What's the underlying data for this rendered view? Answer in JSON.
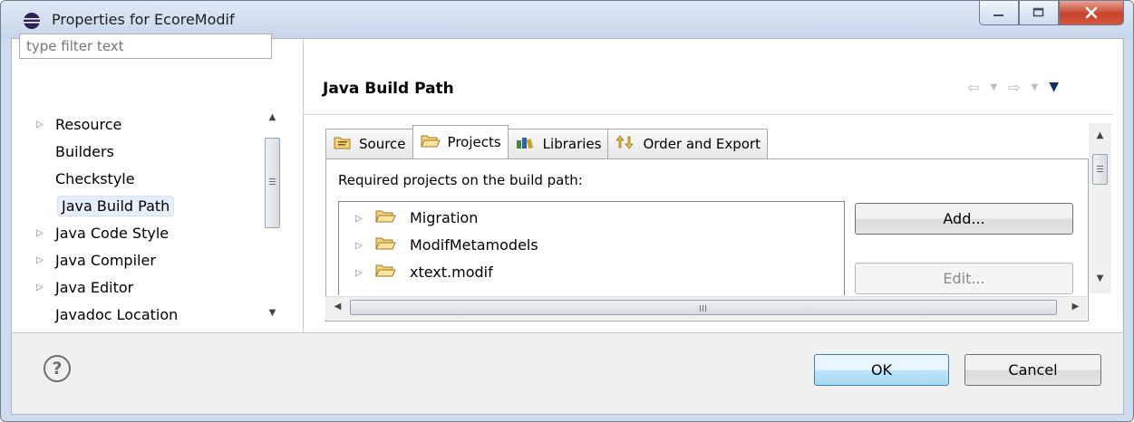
{
  "window": {
    "title": "Properties for EcoreModif"
  },
  "filter": {
    "placeholder": "type filter text"
  },
  "tree": {
    "items": [
      {
        "label": "Resource",
        "expandable": true
      },
      {
        "label": "Builders",
        "expandable": false
      },
      {
        "label": "Checkstyle",
        "expandable": false
      },
      {
        "label": "Java Build Path",
        "expandable": false,
        "selected": true
      },
      {
        "label": "Java Code Style",
        "expandable": true
      },
      {
        "label": "Java Compiler",
        "expandable": true
      },
      {
        "label": "Java Editor",
        "expandable": true
      },
      {
        "label": "Javadoc Location",
        "expandable": false
      }
    ]
  },
  "page": {
    "title": "Java Build Path"
  },
  "tabs": [
    {
      "label": "Source",
      "icon": "source-folder-icon"
    },
    {
      "label": "Projects",
      "icon": "projects-folder-icon",
      "active": true
    },
    {
      "label": "Libraries",
      "icon": "libraries-icon"
    },
    {
      "label": "Order and Export",
      "icon": "order-export-icon"
    }
  ],
  "projects": {
    "label": "Required projects on the build path:",
    "items": [
      "Migration",
      "ModifMetamodels",
      "xtext.modif"
    ]
  },
  "buttons": {
    "add": "Add...",
    "edit": "Edit...",
    "ok": "OK",
    "cancel": "Cancel"
  },
  "colors": {
    "titlebar": "#cfdced",
    "selection": "#e5eff9",
    "close": "#c7432b"
  }
}
